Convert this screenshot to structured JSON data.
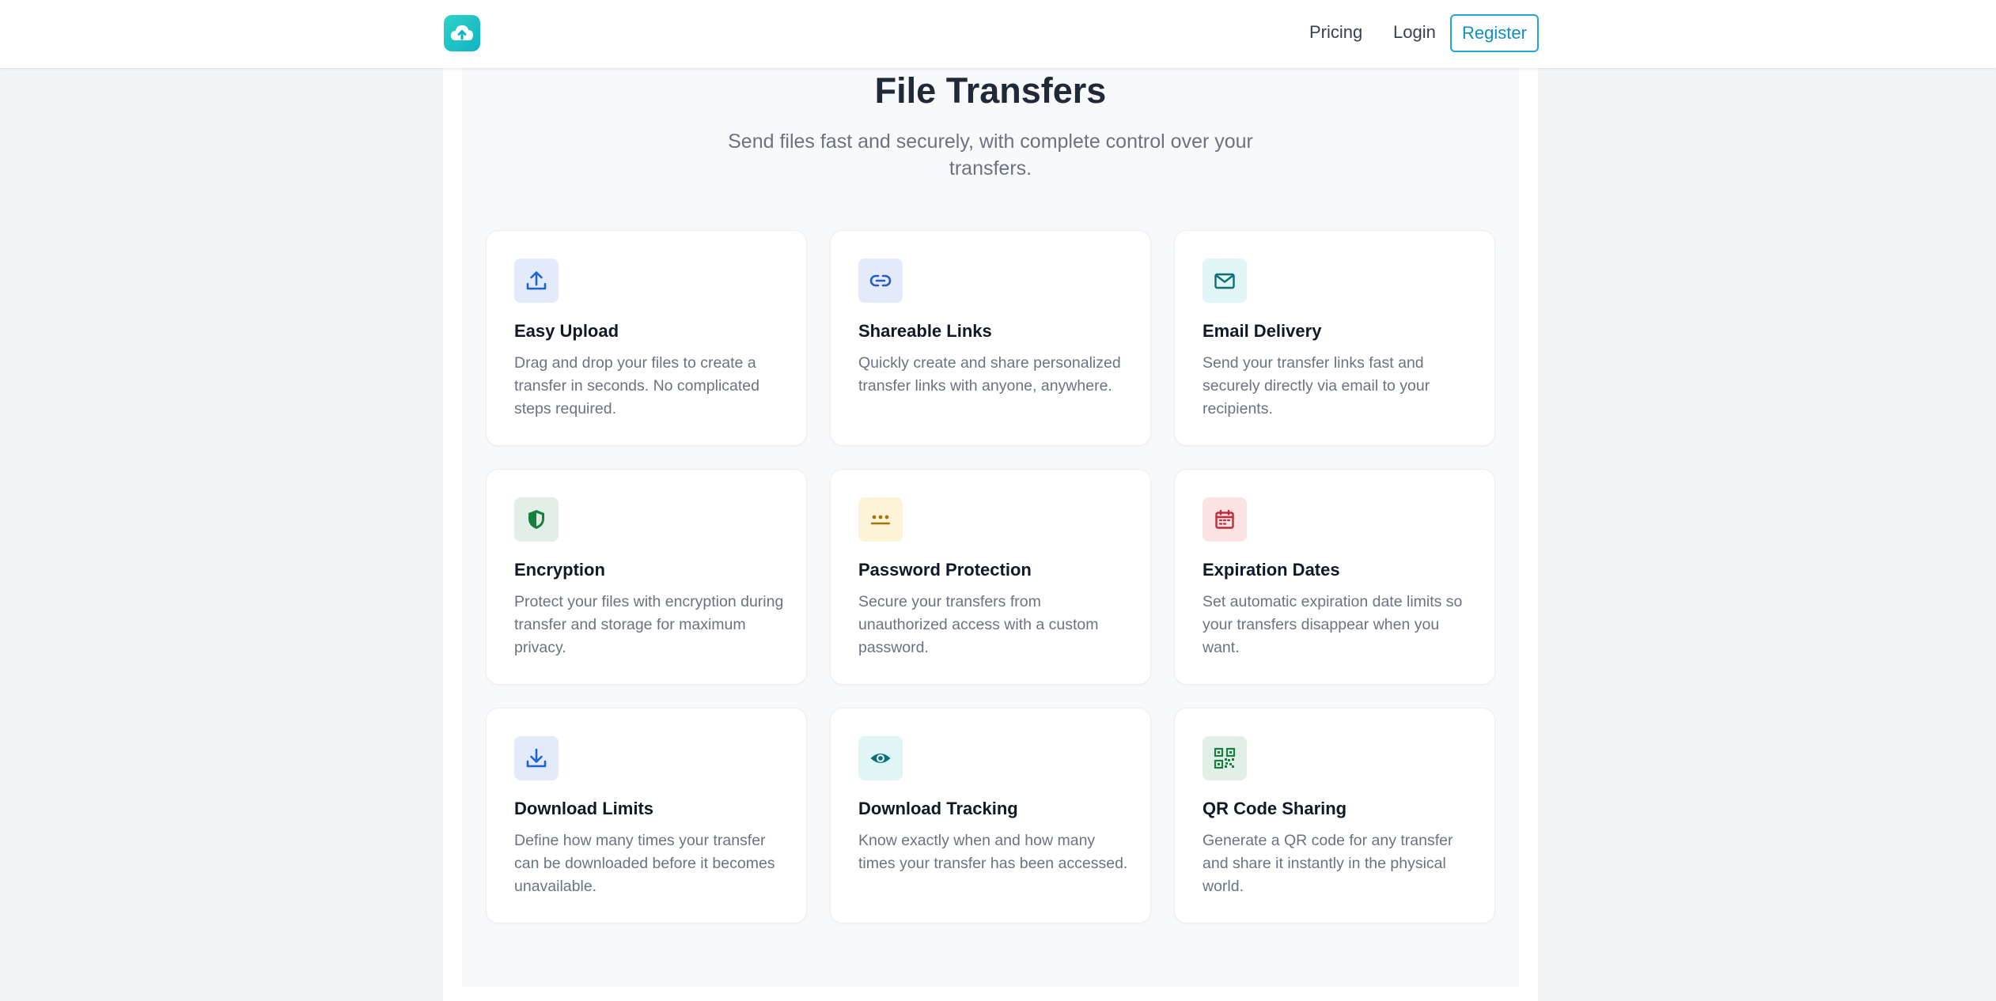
{
  "nav": {
    "pricing": "Pricing",
    "login": "Login",
    "register": "Register"
  },
  "hero": {
    "title": "File Transfers",
    "subtitle": "Send files fast and securely, with complete control over your transfers."
  },
  "features": [
    {
      "icon": "upload-icon",
      "title": "Easy Upload",
      "description": "Drag and drop your files to create a transfer in seconds. No complicated steps required.",
      "icon_bg": "#e3ebfb",
      "icon_color": "#1e63d6"
    },
    {
      "icon": "link-icon",
      "title": "Shareable Links",
      "description": "Quickly create and share personalized transfer links with anyone, anywhere.",
      "icon_bg": "#e3ebfb",
      "icon_color": "#2a59c8"
    },
    {
      "icon": "envelope-icon",
      "title": "Email Delivery",
      "description": "Send your transfer links fast and securely directly via email to your recipients.",
      "icon_bg": "#dff5f6",
      "icon_color": "#0e6f74"
    },
    {
      "icon": "shield-icon",
      "title": "Encryption",
      "description": "Protect your files with encryption during transfer and storage for maximum privacy.",
      "icon_bg": "#e2efe7",
      "icon_color": "#16813f"
    },
    {
      "icon": "password-dots-icon",
      "title": "Password Protection",
      "description": "Secure your transfers from unauthorized access with a custom password.",
      "icon_bg": "#fdf3d6",
      "icon_color": "#a7760b"
    },
    {
      "icon": "calendar-icon",
      "title": "Expiration Dates",
      "description": "Set automatic expiration date limits so your transfers disappear when you want.",
      "icon_bg": "#fbe3e4",
      "icon_color": "#c4283a"
    },
    {
      "icon": "download-icon",
      "title": "Download Limits",
      "description": "Define how many times your transfer can be downloaded before it becomes unavailable.",
      "icon_bg": "#e3ebfb",
      "icon_color": "#1e63d6"
    },
    {
      "icon": "eye-icon",
      "title": "Download Tracking",
      "description": "Know exactly when and how many times your transfer has been accessed.",
      "icon_bg": "#dff5f6",
      "icon_color": "#0e6f74"
    },
    {
      "icon": "qr-code-icon",
      "title": "QR Code Sharing",
      "description": "Generate a QR code for any transfer and share it instantly in the physical world.",
      "icon_bg": "#e2efe7",
      "icon_color": "#16813f"
    }
  ],
  "colors": {
    "brand": "#14c2c4",
    "register_border": "#1ea7d8"
  }
}
